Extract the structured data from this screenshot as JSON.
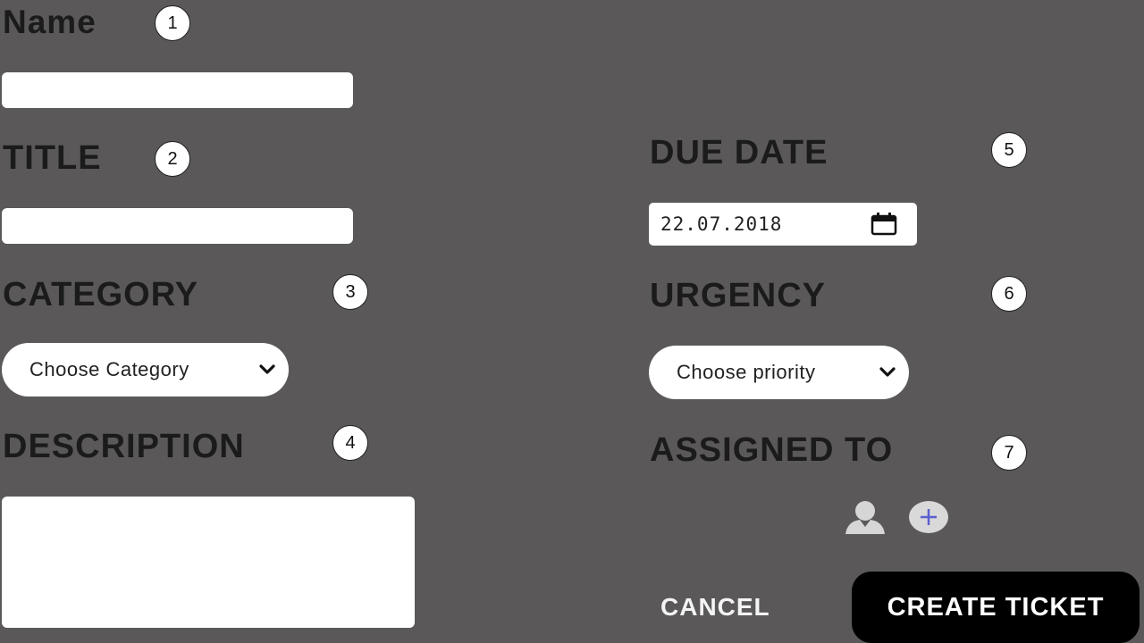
{
  "form": {
    "name": {
      "label": "Name",
      "marker": "1",
      "value": ""
    },
    "title": {
      "label": "TITLE",
      "marker": "2",
      "value": ""
    },
    "category": {
      "label": "CATEGORY",
      "marker": "3",
      "placeholder": "Choose Category"
    },
    "description": {
      "label": "DESCRIPTION",
      "marker": "4",
      "value": ""
    },
    "due_date": {
      "label": "DUE DATE",
      "marker": "5",
      "value": "22.07.2018",
      "icon": "calendar-icon"
    },
    "urgency": {
      "label": "URGENCY",
      "marker": "6",
      "placeholder": "Choose priority"
    },
    "assigned_to": {
      "label": "ASSIGNED TO",
      "marker": "7",
      "icons": [
        "user-avatar-icon",
        "add-circle-icon"
      ]
    }
  },
  "actions": {
    "cancel_label": "CANCEL",
    "create_label": "CREATE TICKET"
  },
  "colors": {
    "background": "#5a5859",
    "label_text": "#1b1b1b",
    "field_bg": "#ffffff",
    "primary_button_bg": "#000000",
    "add_icon_plus": "#5a5fd0"
  }
}
